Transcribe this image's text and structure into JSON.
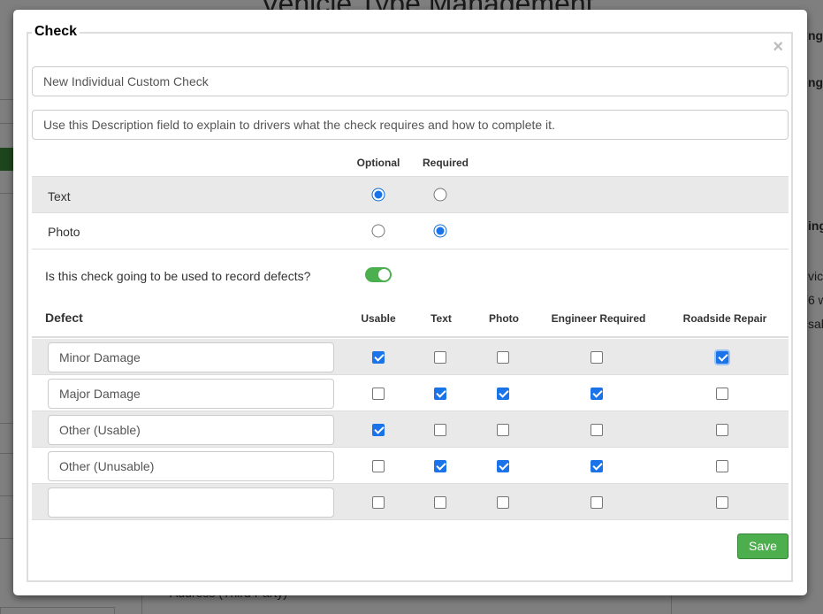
{
  "background": {
    "title": "Vehicle Type Management",
    "right_labels": [
      "ng",
      "ng",
      "ing",
      "vic",
      "6 w",
      "sal"
    ],
    "address_label": "Address (Third Party)"
  },
  "modal": {
    "legend": "Check",
    "close_symbol": "×",
    "name_value": "New Individual Custom Check",
    "description_value": "Use this Description field to explain to drivers what the check requires and how to complete it.",
    "type_columns": [
      "Optional",
      "Required"
    ],
    "type_rows": [
      {
        "label": "Text",
        "selected": "Optional"
      },
      {
        "label": "Photo",
        "selected": "Required"
      }
    ],
    "defect_question": "Is this check going to be used to record defects?",
    "defect_toggle_on": true,
    "defect_header": "Defect",
    "defect_columns": [
      "Usable",
      "Text",
      "Photo",
      "Engineer Required",
      "Roadside Repair"
    ],
    "defects": [
      {
        "name": "Minor Damage",
        "checks": [
          true,
          false,
          false,
          false,
          true
        ]
      },
      {
        "name": "Major Damage",
        "checks": [
          false,
          true,
          true,
          true,
          false
        ]
      },
      {
        "name": "Other (Usable)",
        "checks": [
          true,
          false,
          false,
          false,
          false
        ]
      },
      {
        "name": "Other (Unusable)",
        "checks": [
          false,
          true,
          true,
          true,
          false
        ]
      },
      {
        "name": "",
        "checks": [
          false,
          false,
          false,
          false,
          false
        ]
      }
    ],
    "save_label": "Save"
  },
  "colors": {
    "save_green": "#4cae4c",
    "toggle_green": "#4caf50",
    "checkbox_blue": "#1a73e8",
    "row_shade": "#e9e9e9"
  }
}
